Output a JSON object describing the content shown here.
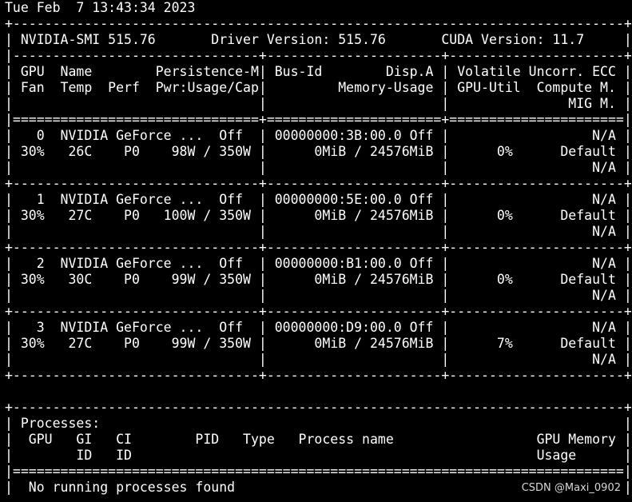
{
  "terminal": {
    "lines": [
      "Tue Feb  7 13:43:34 2023",
      "+-----------------------------------------------------------------------------+",
      "| NVIDIA-SMI 515.76       Driver Version: 515.76       CUDA Version: 11.7     |",
      "|-------------------------------+----------------------+----------------------+",
      "| GPU  Name        Persistence-M| Bus-Id        Disp.A | Volatile Uncorr. ECC |",
      "| Fan  Temp  Perf  Pwr:Usage/Cap|         Memory-Usage | GPU-Util  Compute M. |",
      "|                               |                      |               MIG M. |",
      "|===============================+======================+======================|",
      "|   0  NVIDIA GeForce ...  Off  | 00000000:3B:00.0 Off |                  N/A |",
      "| 30%   26C    P0    98W / 350W |      0MiB / 24576MiB |      0%      Default |",
      "|                               |                      |                  N/A |",
      "+-------------------------------+----------------------+----------------------+",
      "|   1  NVIDIA GeForce ...  Off  | 00000000:5E:00.0 Off |                  N/A |",
      "| 30%   27C    P0   100W / 350W |      0MiB / 24576MiB |      0%      Default |",
      "|                               |                      |                  N/A |",
      "+-------------------------------+----------------------+----------------------+",
      "|   2  NVIDIA GeForce ...  Off  | 00000000:B1:00.0 Off |                  N/A |",
      "| 30%   30C    P0    99W / 350W |      0MiB / 24576MiB |      0%      Default |",
      "|                               |                      |                  N/A |",
      "+-------------------------------+----------------------+----------------------+",
      "|   3  NVIDIA GeForce ...  Off  | 00000000:D9:00.0 Off |                  N/A |",
      "| 30%   27C    P0    99W / 350W |      0MiB / 24576MiB |      7%      Default |",
      "|                               |                      |                  N/A |",
      "+-------------------------------+----------------------+----------------------+",
      "",
      "+-----------------------------------------------------------------------------+",
      "| Processes:                                                                  |",
      "|  GPU   GI   CI        PID   Type   Process name                  GPU Memory |",
      "|        ID   ID                                                   Usage      |",
      "|=============================================================================|",
      "|  No running processes found                                                 |"
    ]
  },
  "watermark": "CSDN @Maxi_0902"
}
